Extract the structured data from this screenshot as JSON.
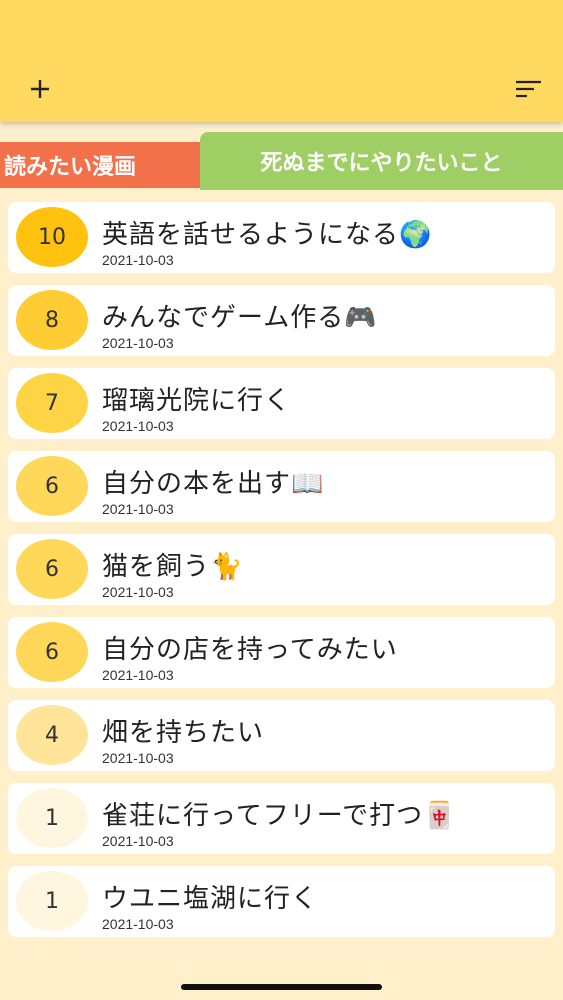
{
  "header": {
    "add_icon": "plus-icon",
    "sort_icon": "sort-icon",
    "color": "#FFD960"
  },
  "tabs": [
    {
      "label": "読みたい漫画",
      "color": "#F2714B",
      "selected": false
    },
    {
      "label": "死ぬまでにやりたいこと",
      "color": "#9FCF64",
      "selected": true
    }
  ],
  "items": [
    {
      "score": "10",
      "title": "英語を話せるようになる🌍",
      "date": "2021-10-03",
      "badge_color": "#FFC20E"
    },
    {
      "score": "8",
      "title": "みんなでゲーム作る🎮",
      "date": "2021-10-03",
      "badge_color": "#FFCD33"
    },
    {
      "score": "7",
      "title": "瑠璃光院に行く",
      "date": "2021-10-03",
      "badge_color": "#FFD444"
    },
    {
      "score": "6",
      "title": "自分の本を出す📖",
      "date": "2021-10-03",
      "badge_color": "#FFD85A"
    },
    {
      "score": "6",
      "title": "猫を飼う🐈",
      "date": "2021-10-03",
      "badge_color": "#FFD85A"
    },
    {
      "score": "6",
      "title": "自分の店を持ってみたい",
      "date": "2021-10-03",
      "badge_color": "#FFD85A"
    },
    {
      "score": "4",
      "title": "畑を持ちたい",
      "date": "2021-10-03",
      "badge_color": "#FFE49A"
    },
    {
      "score": "1",
      "title": "雀荘に行ってフリーで打つ🀄",
      "date": "2021-10-03",
      "badge_color": "#FFF6DF"
    },
    {
      "score": "1",
      "title": "ウユニ塩湖に行く",
      "date": "2021-10-03",
      "badge_color": "#FFF6DF"
    }
  ]
}
